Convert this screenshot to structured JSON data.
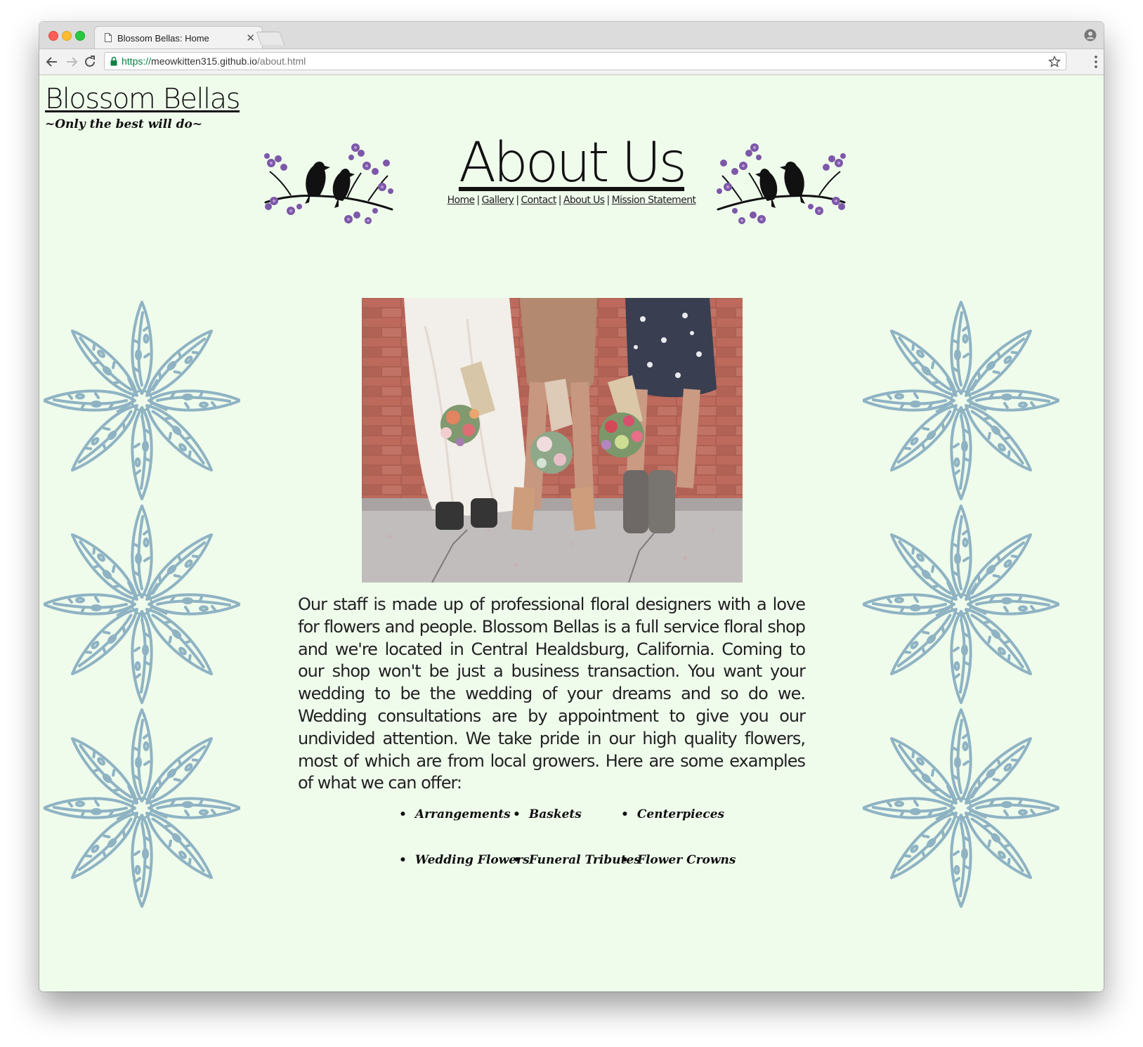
{
  "browser": {
    "tab_title": "Blossom Bellas: Home",
    "tab_close": "✕",
    "url_scheme": "https://",
    "url_host": "meowkitten315.github.io",
    "url_path": "/about.html"
  },
  "site": {
    "logo_title": "Blossom Bellas",
    "tagline": "~Only the best will do~"
  },
  "page": {
    "title": "About Us",
    "nav": [
      {
        "label": "Home"
      },
      {
        "label": "Gallery"
      },
      {
        "label": "Contact"
      },
      {
        "label": "About Us"
      },
      {
        "label": "Mission Statement"
      }
    ],
    "nav_separator": "|",
    "body": "Our staff is made up of professional floral designers with a love for flowers and people. Blossom Bellas is a full service floral shop and we're located in Central Healdsburg, California. Coming to our shop won't be just a business transaction. You want your wedding to be the wedding of your dreams and so do we. Wedding consultations are by appointment to give you our undivided attention. We take pride in our high quality flowers, most of which are from local growers. Here are some examples of what we can offer:",
    "services": [
      "Arrangements",
      "Baskets",
      "Centerpieces",
      "Wedding Flowers",
      "Funeral Tributes",
      "Flower Crowns"
    ]
  },
  "colors": {
    "page_background": "#effcec",
    "lily_blue": "#8fb3c3",
    "blossom_purple": "#7d58a8"
  },
  "icons": {
    "back": "back-arrow-icon",
    "forward": "forward-arrow-icon",
    "reload": "reload-icon",
    "lock": "lock-icon",
    "bookmark": "star-icon",
    "menu": "kebab-menu-icon",
    "profile": "profile-icon",
    "page": "page-icon"
  }
}
